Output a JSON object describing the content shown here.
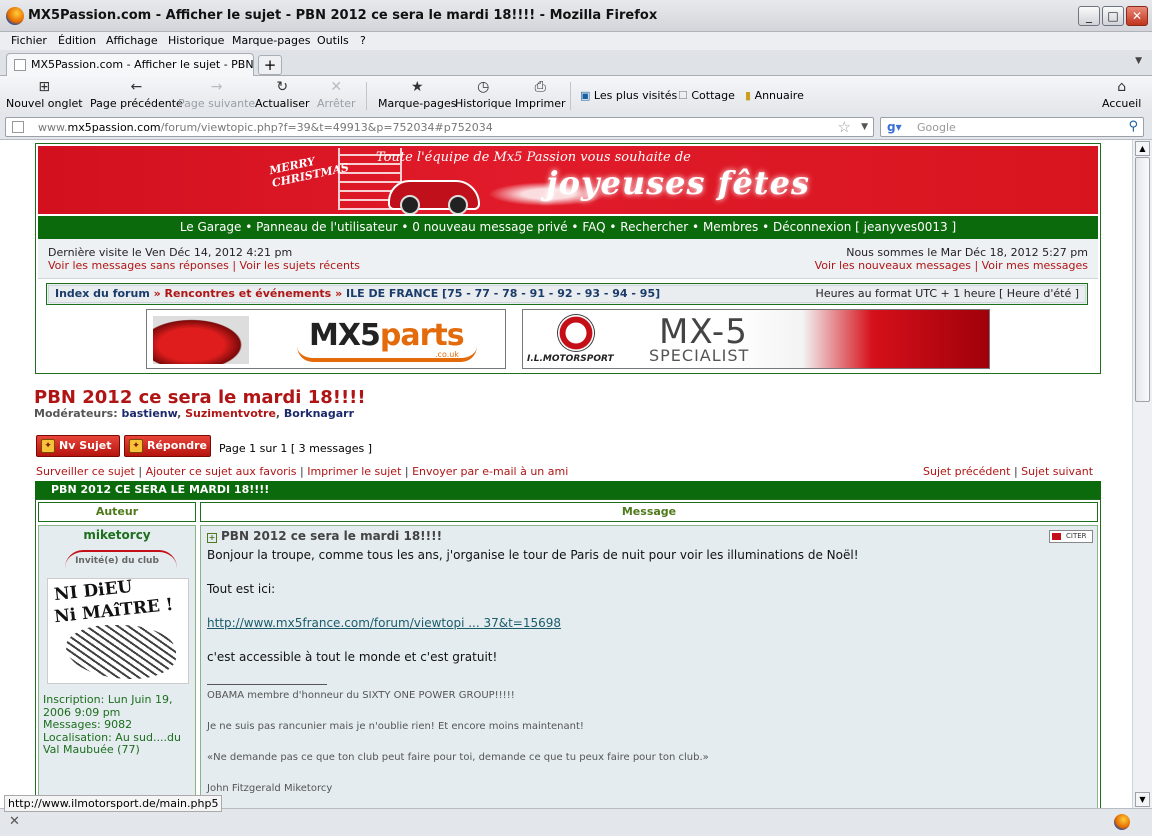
{
  "window": {
    "title": "MX5Passion.com - Afficher le sujet - PBN 2012 ce sera le mardi 18!!!! - Mozilla Firefox"
  },
  "menu": [
    "Fichier",
    "Édition",
    "Affichage",
    "Historique",
    "Marque-pages",
    "Outils",
    "?"
  ],
  "tab": {
    "title": "MX5Passion.com - Afficher le sujet - PBN 20..."
  },
  "toolbar": {
    "new_tab": "Nouvel onglet",
    "back": "Page précédente",
    "forward": "Page suivante",
    "reload": "Actualiser",
    "stop": "Arrêter",
    "bookmarks": "Marque-pages",
    "history": "Historique",
    "print": "Imprimer",
    "bm1": "Les plus visités",
    "bm2": "Cottage",
    "bm3": "Annuaire",
    "home": "Accueil"
  },
  "address": {
    "prefix": "www.",
    "domain": "mx5passion.com",
    "path": "/forum/viewtopic.php?f=39&t=49913&p=752034#p752034"
  },
  "search": {
    "placeholder": "Google"
  },
  "banner": {
    "merry": "MERRY",
    "christmas": "CHRISTMAS",
    "line": "Toute l'équipe de Mx5 Passion vous souhaite de",
    "big": "joyeuses fêtes"
  },
  "nav": {
    "text": "Le Garage  •  Panneau de l'utilisateur  •  0 nouveau message privé  •  FAQ  •  Rechercher  •  Membres  •  Déconnexion [ jeanyves0013 ]"
  },
  "info": {
    "last_visit": "Dernière visite le Ven Déc 14, 2012 4:21 pm",
    "left_links": "Voir les messages sans réponses | Voir les sujets récents",
    "now": "Nous sommes le Mar Déc 18, 2012 5:27 pm",
    "right_links": "Voir les nouveaux messages | Voir mes messages"
  },
  "breadcrumb": {
    "index": "Index du forum",
    "sep1": " » ",
    "cat": "Rencontres et événements",
    "sep2": " » ",
    "forum": "ILE DE FRANCE [75 - 77 - 78 - 91 - 92 - 93 - 94 - 95]",
    "tz": "Heures au format UTC + 1 heure [ Heure d'été ]"
  },
  "ads": {
    "ad1_mx": "MX5",
    "ad1_parts": "parts",
    "ad1_co": ".co.uk",
    "ad2_brand": "I.L.MOTORSPORT",
    "ad2_mx": "MX-5",
    "ad2_spec": "SPECIALIST"
  },
  "topic": {
    "title": "PBN 2012 ce sera le mardi 18!!!!",
    "mods_label": "Modérateurs:",
    "mod1": "bastienw",
    "mod2": "Suzimentvotre",
    "mod3": "Borknagarr",
    "new_topic": "Nv Sujet",
    "reply": "Répondre",
    "page_info": "Page 1 sur 1  [ 3 messages ]",
    "actions": [
      "Surveiller ce sujet",
      "Ajouter ce sujet aux favoris",
      "Imprimer le sujet",
      "Envoyer par e-mail à un ami"
    ],
    "prev": "Sujet précédent",
    "next": "Sujet suivant",
    "header": "PBN 2012 CE SERA LE MARDI 18!!!!"
  },
  "table": {
    "col_author": "Auteur",
    "col_message": "Message"
  },
  "post": {
    "author": "miketorcy",
    "rank": "Invité(e) du club",
    "avatar_l1": "NI DiEU",
    "avatar_l2": "Ni MAîTRE !",
    "joined": "Inscription: Lun Juin 19, 2006 9:09 pm",
    "messages": "Messages: 9082",
    "location": "Localisation: Au sud....du Val Maubuée (77)",
    "subject": "PBN 2012 ce sera le mardi 18!!!!",
    "quote": "CITER",
    "p1": "Bonjour la troupe, comme tous les ans, j'organise le tour de Paris de nuit pour voir les illuminations de Noël!",
    "p2": "Tout est ici:",
    "link": "http://www.mx5france.com/forum/viewtopi ... 37&t=15698",
    "p3": "c'est accessible à tout le monde et c'est gratuit!",
    "sig1": "OBAMA membre d'honneur du SIXTY ONE POWER GROUP!!!!!",
    "sig2": "Je ne suis pas rancunier mais je n'oublie rien! Et encore moins maintenant!",
    "sig3": "«Ne demande pas ce que ton club peut faire pour toi, demande ce que tu peux faire pour ton club.»",
    "sig4": "John Fitzgerald Miketorcy"
  },
  "status": {
    "url": "http://www.ilmotorsport.de/main.php5"
  }
}
